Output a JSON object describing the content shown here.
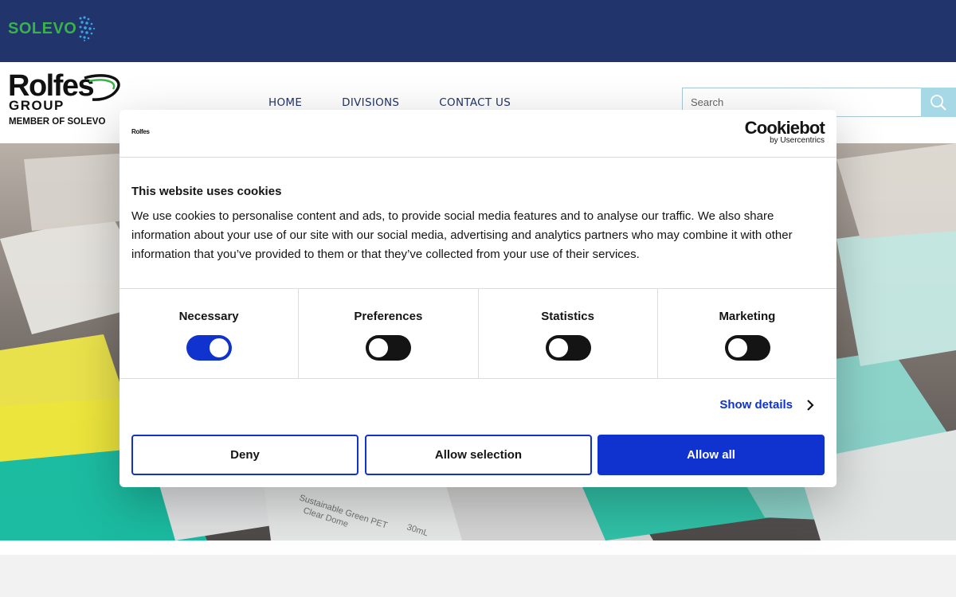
{
  "topbar": {
    "brand_text": "SOLEVO"
  },
  "header": {
    "logo": {
      "word": "Rolfes",
      "group": "GROUP",
      "member": "MEMBER OF SOLEVO"
    },
    "nav": [
      {
        "label": "HOME"
      },
      {
        "label": "DIVISIONS"
      },
      {
        "label": "CONTACT US"
      }
    ],
    "search": {
      "placeholder": "Search",
      "icon": "search-icon"
    }
  },
  "cookie_dialog": {
    "mini_logo": "Rolfes",
    "brand": {
      "name": "Cookiebot",
      "byline": "by Usercentrics"
    },
    "title": "This website uses cookies",
    "body": "We use cookies to personalise content and ads, to provide social media features and to analyse our traffic. We also share information about your use of our site with our social media, advertising and analytics partners who may combine it with other information that you’ve provided to them or that they’ve collected from your use of their services.",
    "categories": [
      {
        "label": "Necessary",
        "enabled": true
      },
      {
        "label": "Preferences",
        "enabled": false
      },
      {
        "label": "Statistics",
        "enabled": false
      },
      {
        "label": "Marketing",
        "enabled": false
      }
    ],
    "show_details": "Show details",
    "buttons": {
      "deny": "Deny",
      "allow_selection": "Allow selection",
      "allow_all": "Allow all"
    },
    "colors": {
      "accent": "#1032cf",
      "toggle_off": "#141414"
    }
  },
  "colors": {
    "topbar": "#21346b",
    "brand_green": "#37b34a",
    "nav_text": "#21346b",
    "search_button": "#a6d8e6"
  }
}
